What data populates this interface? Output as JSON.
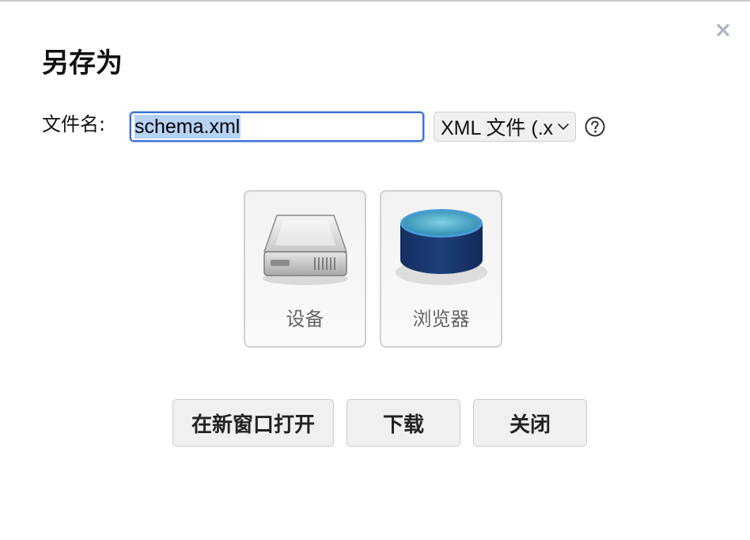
{
  "dialog": {
    "title": "另存为"
  },
  "filename": {
    "label": "文件名:",
    "value": "schema.xml"
  },
  "format_select": {
    "selected": "XML 文件 (.xml)"
  },
  "storage_options": [
    {
      "label": "设备",
      "icon": "hard-drive-icon"
    },
    {
      "label": "浏览器",
      "icon": "database-icon"
    }
  ],
  "buttons": {
    "open_new_window": "在新窗口打开",
    "download": "下载",
    "close": "关闭"
  },
  "colors": {
    "input_focus_border": "#3b6fd6",
    "selection_highlight": "#b6d2f5",
    "browser_icon_blue": "#1e3f7a"
  }
}
